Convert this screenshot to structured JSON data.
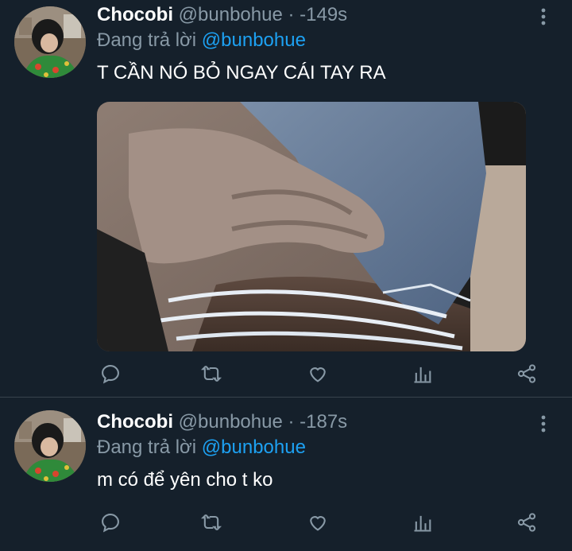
{
  "tweets": [
    {
      "name": "Chocobi",
      "handle": "@bunbohue · -149s",
      "reply_prefix": "Đang trả lời",
      "reply_to": "@bunbohue",
      "text": "T CẦN NÓ BỎ NGAY CÁI TAY RA",
      "has_media": true
    },
    {
      "name": "Chocobi",
      "handle": "@bunbohue · -187s",
      "reply_prefix": "Đang trả lời",
      "reply_to": "@bunbohue",
      "text": "m có để yên cho t ko",
      "has_media": false
    }
  ],
  "icons": [
    "reply-icon",
    "retweet-icon",
    "like-icon",
    "analytics-icon",
    "share-icon",
    "more-icon"
  ],
  "colors": {
    "background": "#15202b",
    "secondary_text": "#8899a6",
    "link": "#1da1f2",
    "divider": "#38444d"
  }
}
